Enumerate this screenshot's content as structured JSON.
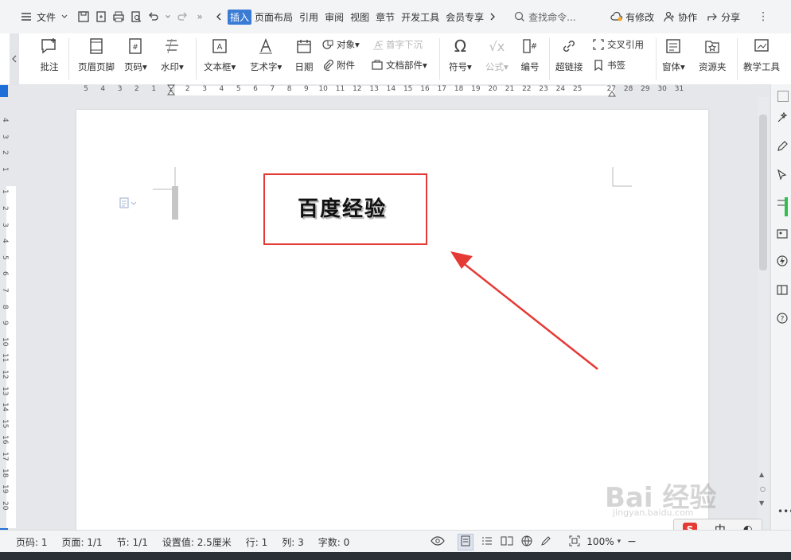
{
  "topbar": {
    "menu_label": "文件",
    "tabs": [
      "插入",
      "页面布局",
      "引用",
      "审阅",
      "视图",
      "章节",
      "开发工具",
      "会员专享"
    ],
    "active_tab": "插入",
    "search_placeholder": "查找命令...",
    "modified_label": "有修改",
    "collab_label": "协作",
    "share_label": "分享"
  },
  "ribbon": {
    "comment": "批注",
    "header_footer": "页眉页脚",
    "page_number": "页码",
    "watermark": "水印",
    "textbox": "文本框",
    "art_text": "艺术字",
    "date": "日期",
    "object": "对象",
    "attachment": "附件",
    "drop_cap": "首字下沉",
    "doc_parts": "文档部件",
    "symbol": "符号",
    "formula": "公式",
    "numbering": "编号",
    "hyperlink": "超链接",
    "cross_ref": "交叉引用",
    "bookmark": "书签",
    "window": "窗体",
    "resources": "资源夹",
    "teaching_tools": "教学工具"
  },
  "document": {
    "text": "百度经验"
  },
  "statusbar": {
    "page_num": "页码: 1",
    "page_count": "页面: 1/1",
    "section": "节: 1/1",
    "setting": "设置值: 2.5厘米",
    "row": "行: 1",
    "col": "列: 3",
    "word_count": "字数: 0",
    "zoom": "100%"
  },
  "ime": {
    "mode": "中"
  },
  "watermark": {
    "brand": "Bai 经验",
    "url": "jingyan.baidu.com"
  },
  "colors": {
    "accent": "#3a7bd5",
    "annotation_red": "#e53935"
  },
  "ruler": {
    "h_numbers": [
      "5",
      "4",
      "3",
      "2",
      "1",
      "1",
      "2",
      "3",
      "4",
      "5",
      "6",
      "7",
      "8",
      "9",
      "10",
      "11",
      "12",
      "13",
      "14",
      "15",
      "16",
      "17",
      "18",
      "19",
      "20",
      "21",
      "22",
      "23",
      "24",
      "25",
      "27",
      "28",
      "29",
      "30",
      "31"
    ],
    "v_numbers": [
      "4",
      "3",
      "2",
      "1",
      "1",
      "2",
      "3",
      "4",
      "5",
      "6",
      "7",
      "8",
      "9",
      "10",
      "11",
      "12",
      "13",
      "14",
      "15",
      "16",
      "17",
      "18",
      "19",
      "20"
    ]
  }
}
